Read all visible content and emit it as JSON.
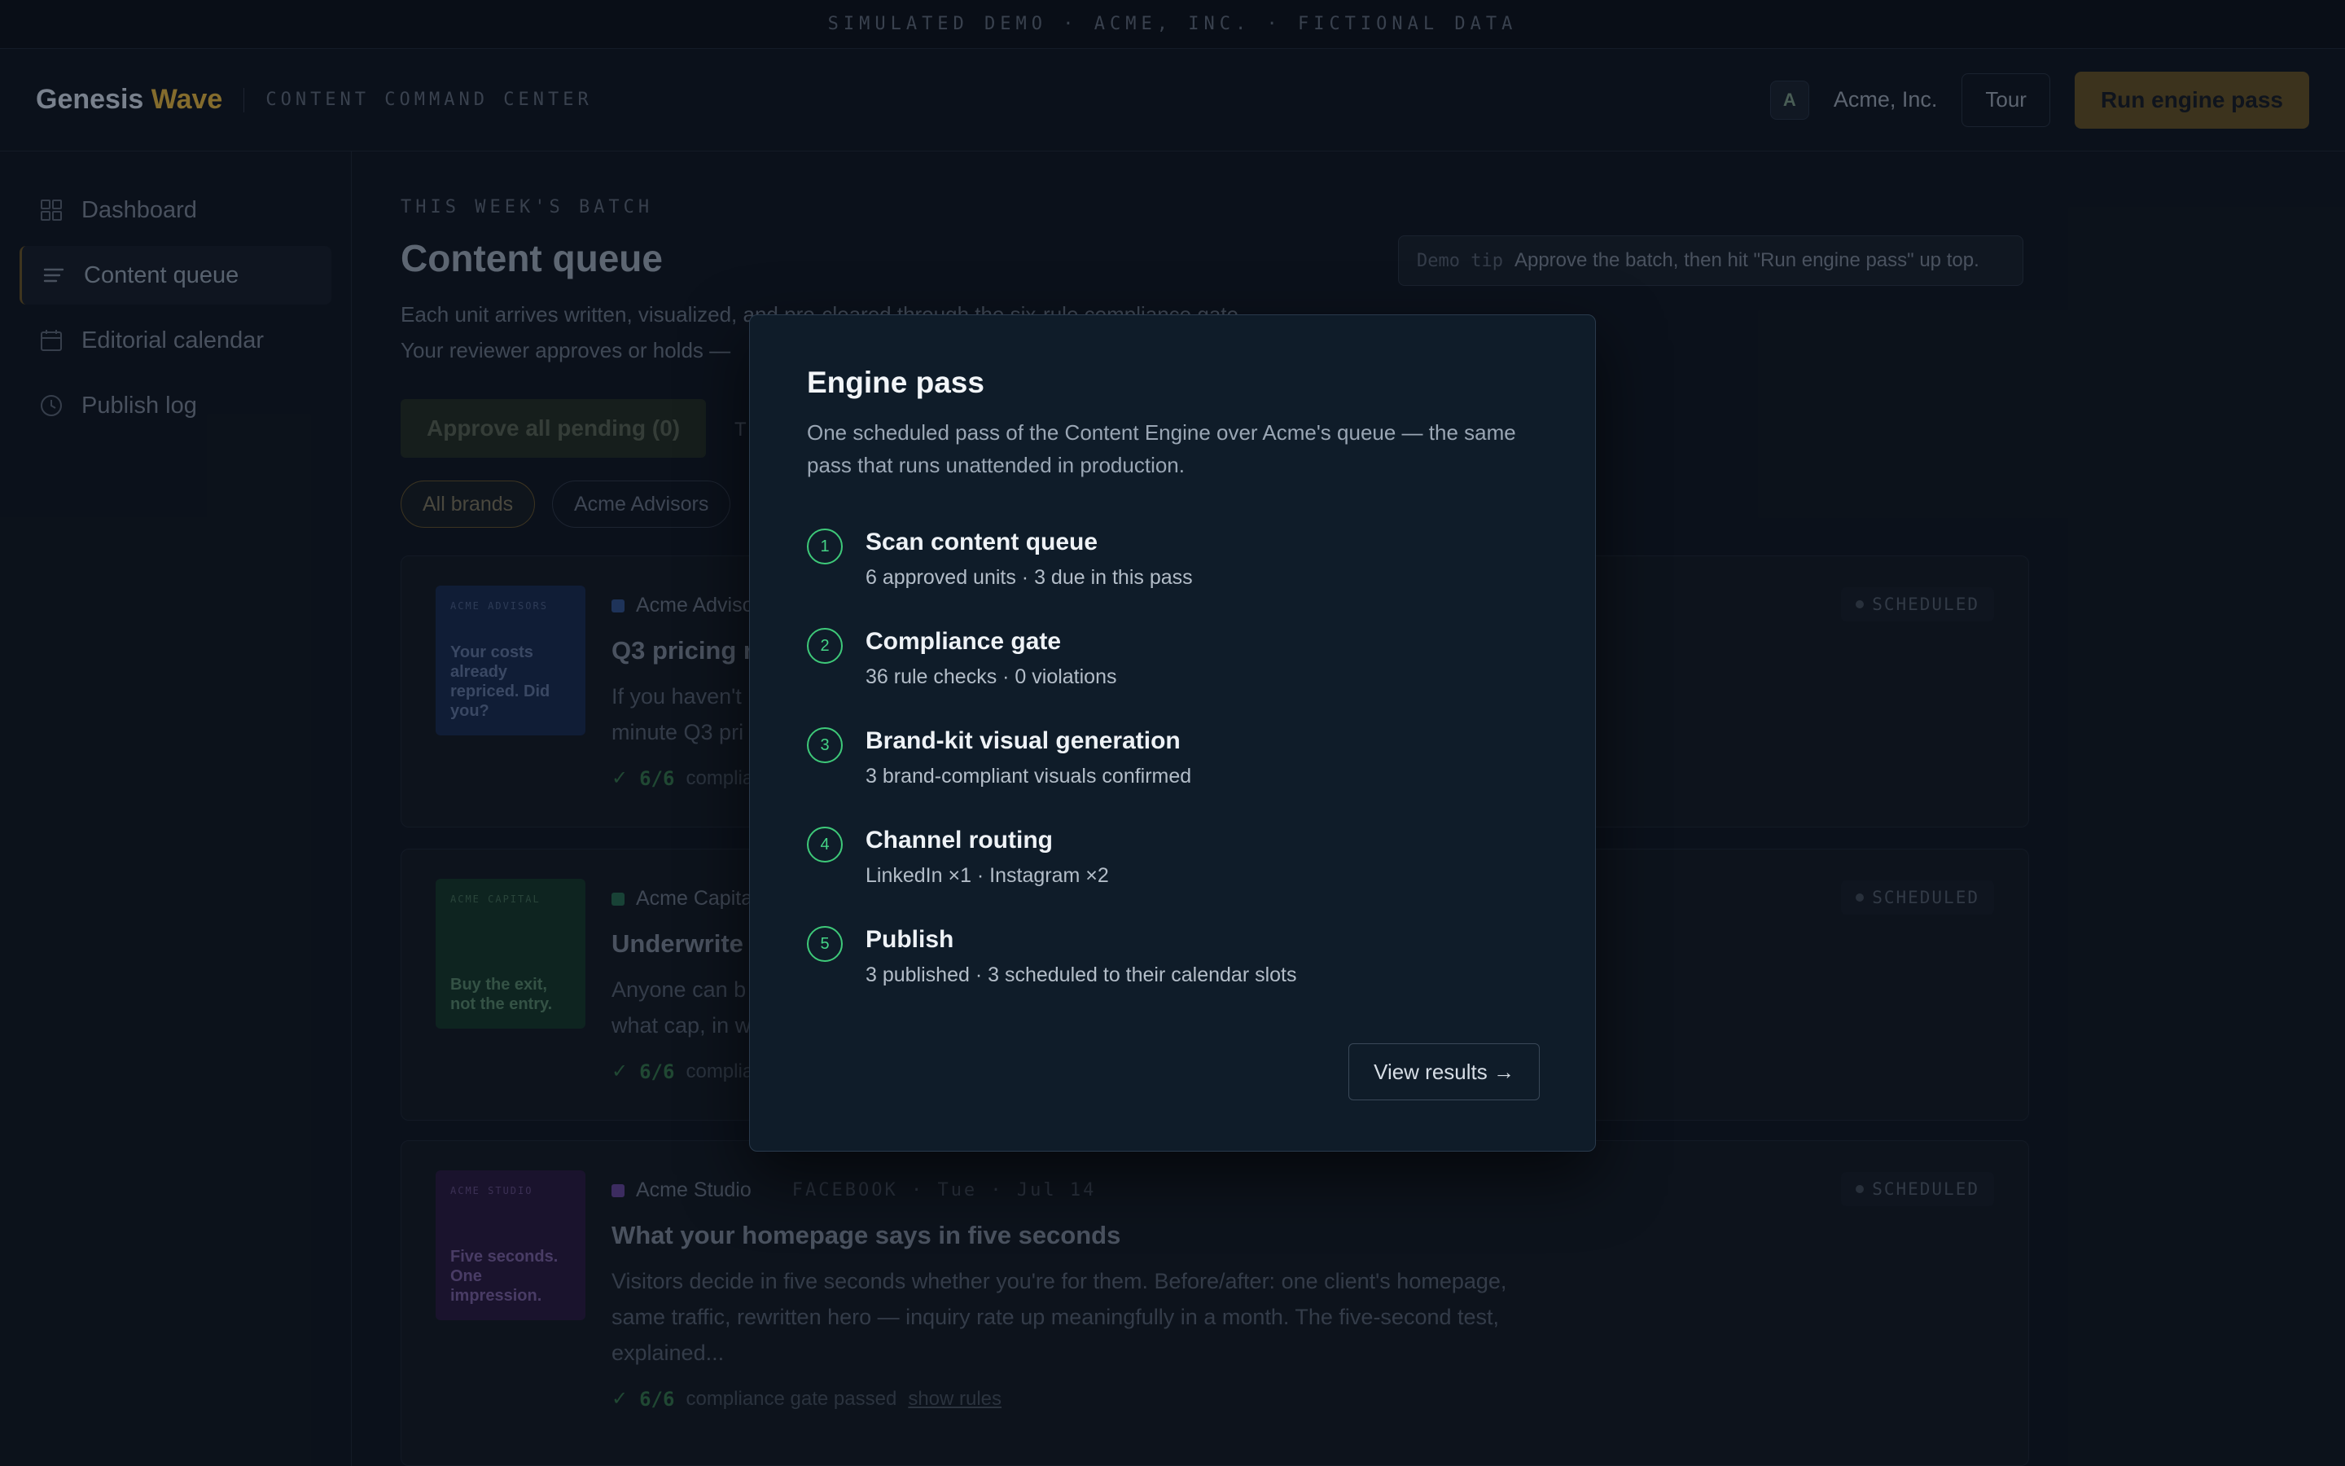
{
  "demo_strip": "SIMULATED DEMO · ACME, INC. · FICTIONAL DATA",
  "header": {
    "logo_main": "Genesis",
    "logo_accent": "Wave",
    "logo_sub": "CONTENT COMMAND CENTER",
    "avatar_letter": "A",
    "org_name": "Acme, Inc.",
    "tour_label": "Tour",
    "run_label": "Run engine pass"
  },
  "sidebar": {
    "items": [
      {
        "label": "Dashboard",
        "icon": "grid-icon"
      },
      {
        "label": "Content queue",
        "icon": "list-icon",
        "active": true
      },
      {
        "label": "Editorial calendar",
        "icon": "calendar-icon"
      },
      {
        "label": "Publish log",
        "icon": "clock-icon"
      }
    ]
  },
  "main": {
    "eyebrow": "THIS WEEK'S BATCH",
    "title": "Content queue",
    "desc_line1": "Each unit arrives written, visualized, and pre-cleared through the six-rule compliance gate.",
    "desc_line2": "Your reviewer approves or holds —",
    "demo_tip_tag": "Demo tip",
    "demo_tip_text": "Approve the batch, then hit \"Run engine pass\" up top.",
    "approve_label": "Approve all pending (0)",
    "approve_ghost": "T",
    "filters": [
      "All brands",
      "Acme Advisors"
    ]
  },
  "cards": [
    {
      "thumb_brand": "ACME ADVISORS",
      "thumb_text": "Your costs already repriced. Did you?",
      "brand": "Acme Advisors",
      "title": "Q3 pricing r",
      "body_line1": "If you haven't",
      "body_line2": "minute Q3 pri",
      "score": "6/6",
      "foot": "complia",
      "status": "SCHEDULED"
    },
    {
      "thumb_brand": "ACME CAPITAL",
      "thumb_text": "Buy the exit, not the entry.",
      "brand": "Acme Capita",
      "title": "Underwrite",
      "body_line1": "Anyone can b",
      "body_line2": "what cap, in w",
      "score": "6/6",
      "foot": "complia",
      "status": "SCHEDULED"
    },
    {
      "thumb_brand": "ACME STUDIO",
      "thumb_text": "Five seconds. One impression.",
      "brand": "Acme Studio",
      "channel": "FACEBOOK · Tue · Jul 14",
      "title": "What your homepage says in five seconds",
      "body_line1": "Visitors decide in five seconds whether you're for them. Before/after: one client's homepage,",
      "body_line2": "same traffic, rewritten hero — inquiry rate up meaningfully in a month. The five-second test,",
      "body_line3": "explained...",
      "score": "6/6",
      "foot": "compliance gate passed",
      "foot_link": "show rules",
      "status": "SCHEDULED"
    }
  ],
  "modal": {
    "title": "Engine pass",
    "desc": "One scheduled pass of the Content Engine over Acme's queue — the same pass that runs unattended in production.",
    "steps": [
      {
        "num": "1",
        "title": "Scan content queue",
        "sub": "6 approved units · 3 due in this pass"
      },
      {
        "num": "2",
        "title": "Compliance gate",
        "sub": "36 rule checks · 0 violations"
      },
      {
        "num": "3",
        "title": "Brand-kit visual generation",
        "sub": "3 brand-compliant visuals confirmed"
      },
      {
        "num": "4",
        "title": "Channel routing",
        "sub": "LinkedIn ×1 · Instagram ×2"
      },
      {
        "num": "5",
        "title": "Publish",
        "sub": "3 published · 3 scheduled to their calendar slots"
      }
    ],
    "view_results": "View results →"
  },
  "colors": {
    "accent_gold": "#c8a13d",
    "step_green": "#3ec979",
    "modal_bg": "#0f1c29"
  }
}
